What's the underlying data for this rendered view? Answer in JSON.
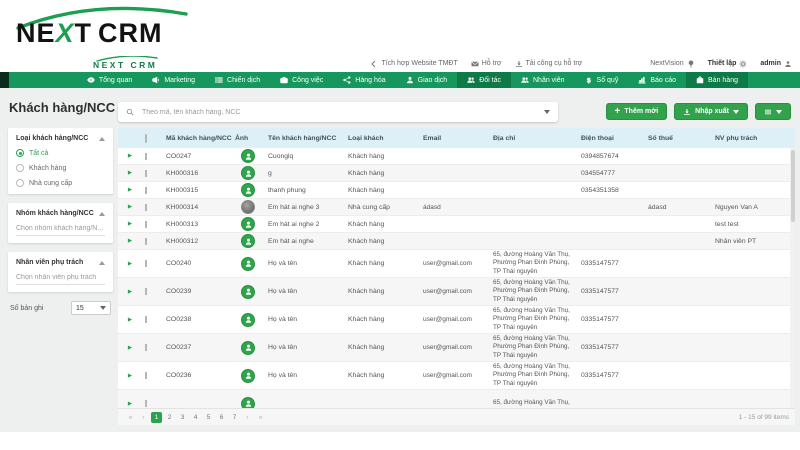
{
  "brand": {
    "logo_left": "NE",
    "logo_x": "X",
    "logo_right": "T",
    "logo_suffix": "CRM",
    "logo_small": "NEXT CRM"
  },
  "utility": {
    "items": [
      {
        "label": "Tích hợp Website TMĐT",
        "icon": "chevron-left-icon"
      },
      {
        "label": "Hỗ trợ",
        "icon": "mail-icon"
      },
      {
        "label": "Tải công cụ hỗ trợ",
        "icon": "download-icon"
      },
      {
        "label": "NextVision",
        "icon": "lightbulb-icon",
        "icon_after": true,
        "spaced": true
      },
      {
        "label": "Thiết lập",
        "icon": "gear-icon",
        "icon_after": true,
        "bold": true
      },
      {
        "label": "admin",
        "icon": "user-gear-icon",
        "icon_after": true,
        "bold": true
      }
    ]
  },
  "nav": {
    "items": [
      {
        "label": "Tổng quan",
        "icon": "eye-icon",
        "active": false
      },
      {
        "label": "Marketing",
        "icon": "megaphone-icon",
        "active": false
      },
      {
        "label": "Chiến dịch",
        "icon": "list-icon",
        "active": false
      },
      {
        "label": "Công việc",
        "icon": "briefcase-icon",
        "active": false
      },
      {
        "label": "Hàng hóa",
        "icon": "share-icon",
        "active": false
      },
      {
        "label": "Giao dịch",
        "icon": "person-icon",
        "active": false
      },
      {
        "label": "Đối tác",
        "icon": "people-icon",
        "active": true
      },
      {
        "label": "Nhân viên",
        "icon": "people-icon",
        "active": false
      },
      {
        "label": "Số quỹ",
        "icon": "dollar-icon",
        "active": false
      },
      {
        "label": "Báo cáo",
        "icon": "chart-icon",
        "active": false
      }
    ],
    "right_item": {
      "label": "Bán hàng",
      "icon": "bag-icon",
      "active": true
    }
  },
  "page": {
    "title": "Khách hàng/NCC",
    "collapse_icon": "«"
  },
  "search": {
    "placeholder": "Theo mã, tên khách hàng, NCC"
  },
  "toolbar": {
    "add_label": "Thêm mới",
    "import_export_label": "Nhập xuất"
  },
  "sidebar": {
    "type_filter": {
      "title": "Loại khách hàng/NCC",
      "options": [
        {
          "label": "Tất cả",
          "selected": true
        },
        {
          "label": "Khách hàng",
          "selected": false
        },
        {
          "label": "Nhà cung cấp",
          "selected": false
        }
      ]
    },
    "group_filter": {
      "title": "Nhóm khách hàng/NCC",
      "placeholder": "Chọn nhóm khách hàng/N..."
    },
    "staff_filter": {
      "title": "Nhân viên phụ trách",
      "placeholder": "Chọn nhân viên phụ trách"
    },
    "records": {
      "label": "Số bản ghi",
      "value": "15"
    }
  },
  "table": {
    "columns": [
      "Mã khách hàng/NCC",
      "Ảnh",
      "Tên khách hàng/NCC",
      "Loại khách",
      "Email",
      "Địa chỉ",
      "Điện thoại",
      "Số thuế",
      "NV phụ trách"
    ],
    "rows": [
      {
        "code": "CO0247",
        "avatar": "green",
        "name": "Cuonglq",
        "type": "Khách hàng",
        "email": "",
        "address": "",
        "phone": "0394857674",
        "tax": "",
        "staff": ""
      },
      {
        "code": "KH000316",
        "avatar": "green",
        "name": "g",
        "type": "Khách hàng",
        "email": "",
        "address": "",
        "phone": "034554777",
        "tax": "",
        "staff": ""
      },
      {
        "code": "KH000315",
        "avatar": "green",
        "name": "thanh phung",
        "type": "Khách hàng",
        "email": "",
        "address": "",
        "phone": "0354351358",
        "tax": "",
        "staff": ""
      },
      {
        "code": "KH000314",
        "avatar": "photo",
        "name": "Em hát ai nghe 3",
        "type": "Nhà cung cấp",
        "email": "ádasd",
        "address": "",
        "phone": "",
        "tax": "ádasd",
        "staff": "Nguyen Van A"
      },
      {
        "code": "KH000313",
        "avatar": "green",
        "name": "Em hát ai nghe 2",
        "type": "Khách hàng",
        "email": "",
        "address": "",
        "phone": "",
        "tax": "",
        "staff": "test test"
      },
      {
        "code": "KH000312",
        "avatar": "green",
        "name": "Em hát ai nghe",
        "type": "Khách hàng",
        "email": "",
        "address": "",
        "phone": "",
        "tax": "",
        "staff": "Nhân viên PT"
      },
      {
        "code": "CO0240",
        "avatar": "green",
        "name": "Họ và tên",
        "type": "Khách hàng",
        "email": "user@gmail.com",
        "address": "65, đường Hoàng Văn Thụ, Phường Phan Đình Phùng, TP Thái nguyên",
        "phone": "0335147577",
        "tax": "",
        "staff": ""
      },
      {
        "code": "CO0239",
        "avatar": "green",
        "name": "Họ và tên",
        "type": "Khách hàng",
        "email": "user@gmail.com",
        "address": "65, đường Hoàng Văn Thụ, Phường Phan Đình Phùng, TP Thái nguyên",
        "phone": "0335147577",
        "tax": "",
        "staff": ""
      },
      {
        "code": "CO0238",
        "avatar": "green",
        "name": "Họ và tên",
        "type": "Khách hàng",
        "email": "user@gmail.com",
        "address": "65, đường Hoàng Văn Thụ, Phường Phan Đình Phùng, TP Thái nguyên",
        "phone": "0335147577",
        "tax": "",
        "staff": ""
      },
      {
        "code": "CO0237",
        "avatar": "green",
        "name": "Họ và tên",
        "type": "Khách hàng",
        "email": "user@gmail.com",
        "address": "65, đường Hoàng Văn Thụ, Phường Phan Đình Phùng, TP Thái nguyên",
        "phone": "0335147577",
        "tax": "",
        "staff": ""
      },
      {
        "code": "CO0236",
        "avatar": "green",
        "name": "Họ và tên",
        "type": "Khách hàng",
        "email": "user@gmail.com",
        "address": "65, đường Hoàng Văn Thụ, Phường Phan Đình Phùng, TP Thái nguyên",
        "phone": "0335147577",
        "tax": "",
        "staff": ""
      },
      {
        "code": "",
        "avatar": "green",
        "name": "",
        "type": "",
        "email": "",
        "address": "65, đường Hoàng Văn Thụ,",
        "phone": "",
        "tax": "",
        "staff": ""
      }
    ]
  },
  "pagination": {
    "first": "«",
    "prev": "‹",
    "pages": [
      "1",
      "2",
      "3",
      "4",
      "5",
      "6",
      "7"
    ],
    "current": "1",
    "next": "›",
    "last": "»",
    "info": "1 - 15 of 99 items"
  },
  "colors": {
    "nav_green": "#15975d",
    "nav_active": "#0d7a48",
    "accent_green": "#2aa251",
    "header_blue": "#ddeff7"
  }
}
